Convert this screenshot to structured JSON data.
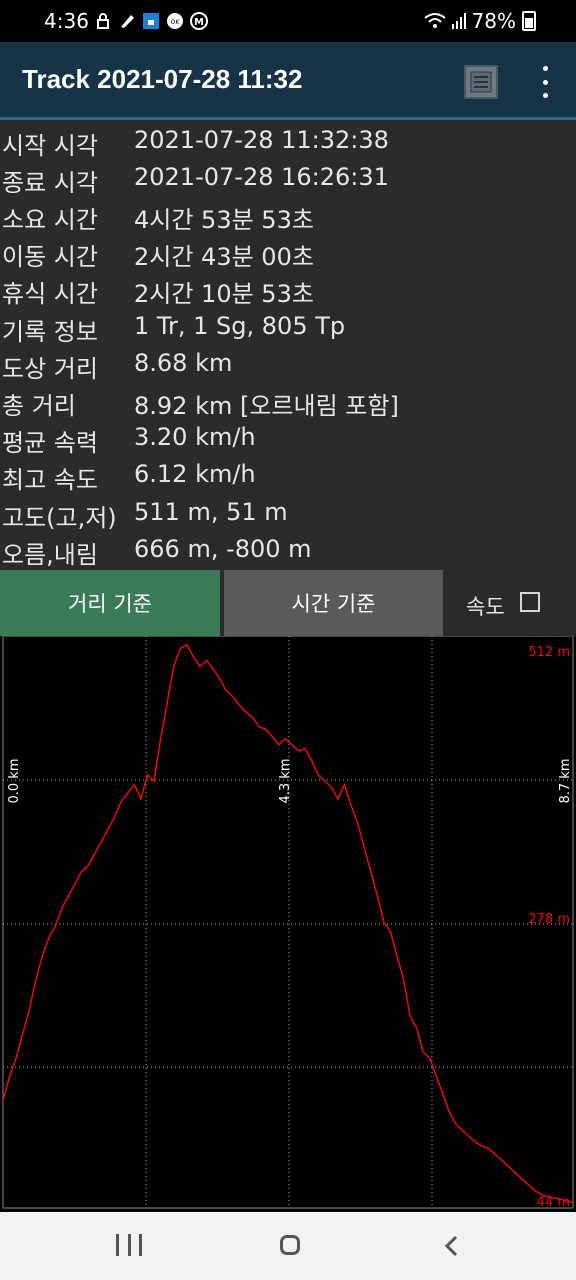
{
  "status_bar": {
    "time": "4:36",
    "battery": "78%"
  },
  "app_bar": {
    "title": "Track 2021-07-28 11:32"
  },
  "info": [
    {
      "label": "시작 시각",
      "value": "2021-07-28 11:32:38"
    },
    {
      "label": "종료 시각",
      "value": "2021-07-28 16:26:31"
    },
    {
      "label": "소요 시간",
      "value": "4시간 53분 53초"
    },
    {
      "label": "이동 시간",
      "value": "2시간 43분 00초"
    },
    {
      "label": "휴식 시간",
      "value": "2시간 10분 53초"
    },
    {
      "label": "기록 정보",
      "value": "1 Tr, 1 Sg, 805 Tp"
    },
    {
      "label": "도상 거리",
      "value": "8.68 km"
    },
    {
      "label": "총 거리",
      "value": "8.92 km [오르내림 포함]"
    },
    {
      "label": "평균 속력",
      "value": "3.20 km/h"
    },
    {
      "label": "최고 속도",
      "value": "6.12 km/h"
    },
    {
      "label": "고도(고,저)",
      "value": "511 m, 51 m"
    },
    {
      "label": "오름,내림",
      "value": "666 m, -800 m"
    }
  ],
  "tabs": {
    "distance": "거리 기준",
    "time": "시간 기준",
    "speed": "속도",
    "speed_checked": false
  },
  "colors": {
    "line": "#e01010",
    "accent_tab": "#3a7c57",
    "appbar": "#173447"
  },
  "chart_data": {
    "type": "line",
    "x_tick_labels": [
      "0.0 km",
      "4.3 km",
      "8.7 km"
    ],
    "y_tick_labels": [
      "512 m",
      "278 m",
      "44 m"
    ],
    "xlim": [
      0,
      8.68
    ],
    "ylim": [
      44,
      512
    ],
    "grid": true,
    "x": [
      0.0,
      0.1,
      0.2,
      0.3,
      0.4,
      0.5,
      0.6,
      0.7,
      0.8,
      0.9,
      1.0,
      1.1,
      1.2,
      1.3,
      1.4,
      1.5,
      1.6,
      1.7,
      1.8,
      1.9,
      2.0,
      2.1,
      2.2,
      2.3,
      2.4,
      2.5,
      2.6,
      2.7,
      2.8,
      2.9,
      3.0,
      3.1,
      3.2,
      3.3,
      3.4,
      3.5,
      3.6,
      3.7,
      3.8,
      3.9,
      4.0,
      4.1,
      4.2,
      4.3,
      4.4,
      4.5,
      4.6,
      4.7,
      4.8,
      4.9,
      5.0,
      5.1,
      5.2,
      5.3,
      5.4,
      5.5,
      5.6,
      5.7,
      5.8,
      5.9,
      6.0,
      6.1,
      6.2,
      6.3,
      6.4,
      6.5,
      6.6,
      6.7,
      6.8,
      6.9,
      7.0,
      7.1,
      7.2,
      7.3,
      7.4,
      7.5,
      7.6,
      7.7,
      7.8,
      7.9,
      8.0,
      8.1,
      8.2,
      8.3,
      8.4,
      8.5,
      8.6,
      8.68
    ],
    "y": [
      130,
      150,
      165,
      185,
      205,
      230,
      250,
      265,
      275,
      290,
      300,
      310,
      320,
      325,
      335,
      345,
      355,
      365,
      378,
      385,
      392,
      380,
      400,
      395,
      430,
      460,
      490,
      505,
      508,
      498,
      490,
      495,
      488,
      480,
      470,
      465,
      458,
      452,
      448,
      440,
      438,
      432,
      425,
      430,
      425,
      420,
      422,
      412,
      400,
      395,
      390,
      380,
      392,
      375,
      360,
      340,
      320,
      300,
      278,
      270,
      250,
      230,
      200,
      190,
      170,
      165,
      150,
      135,
      120,
      110,
      105,
      100,
      95,
      92,
      90,
      85,
      80,
      75,
      70,
      65,
      60,
      55,
      52,
      50,
      49,
      48,
      46,
      45
    ]
  }
}
